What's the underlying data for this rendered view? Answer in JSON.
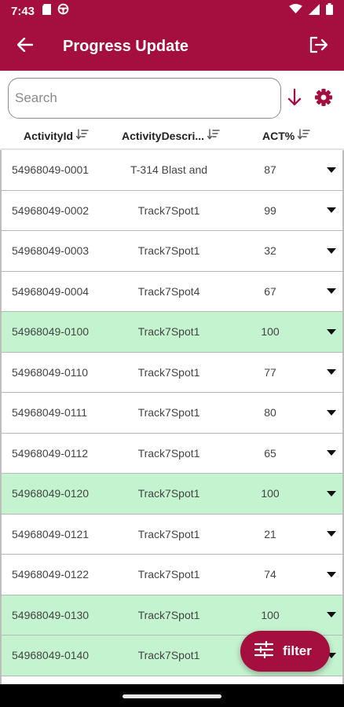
{
  "status_bar": {
    "time": "7:43",
    "icons": [
      "sd-card-icon",
      "steering-icon",
      "wifi-icon",
      "signal-icon",
      "battery-icon"
    ]
  },
  "app_bar": {
    "title": "Progress Update",
    "back_icon": "arrow-back-icon",
    "logout_icon": "logout-icon"
  },
  "search": {
    "placeholder": "Search",
    "value": "",
    "sort_icon": "arrow-down-icon",
    "settings_icon": "gear-icon"
  },
  "columns": [
    {
      "label": "ActivityId",
      "icon": "sort-icon"
    },
    {
      "label": "ActivityDescri...",
      "icon": "sort-icon"
    },
    {
      "label": "ACT%",
      "icon": "sort-icon"
    }
  ],
  "rows": [
    {
      "id": "54968049-0001",
      "desc": "T-314 Blast and",
      "act": "87",
      "complete": false
    },
    {
      "id": "54968049-0002",
      "desc": "Track7Spot1",
      "act": "99",
      "complete": false
    },
    {
      "id": "54968049-0003",
      "desc": "Track7Spot1",
      "act": "32",
      "complete": false
    },
    {
      "id": "54968049-0004",
      "desc": "Track7Spot4",
      "act": "67",
      "complete": false
    },
    {
      "id": "54968049-0100",
      "desc": "Track7Spot1",
      "act": "100",
      "complete": true
    },
    {
      "id": "54968049-0110",
      "desc": "Track7Spot1",
      "act": "77",
      "complete": false
    },
    {
      "id": "54968049-0111",
      "desc": "Track7Spot1",
      "act": "80",
      "complete": false
    },
    {
      "id": "54968049-0112",
      "desc": "Track7Spot1",
      "act": "65",
      "complete": false
    },
    {
      "id": "54968049-0120",
      "desc": "Track7Spot1",
      "act": "100",
      "complete": true
    },
    {
      "id": "54968049-0121",
      "desc": "Track7Spot1",
      "act": "21",
      "complete": false
    },
    {
      "id": "54968049-0122",
      "desc": "Track7Spot1",
      "act": "74",
      "complete": false
    },
    {
      "id": "54968049-0130",
      "desc": "Track7Spot1",
      "act": "100",
      "complete": true
    },
    {
      "id": "54968049-0140",
      "desc": "Track7Spot1",
      "act": "",
      "complete": true
    },
    {
      "id": "",
      "desc": "",
      "act": "",
      "complete": false
    }
  ],
  "row_menu_icon": "dropdown-arrow-icon",
  "fab": {
    "label": "filter",
    "icon": "tune-icon"
  },
  "colors": {
    "primary": "#a50f3f",
    "complete_row": "#c4f3cf"
  }
}
